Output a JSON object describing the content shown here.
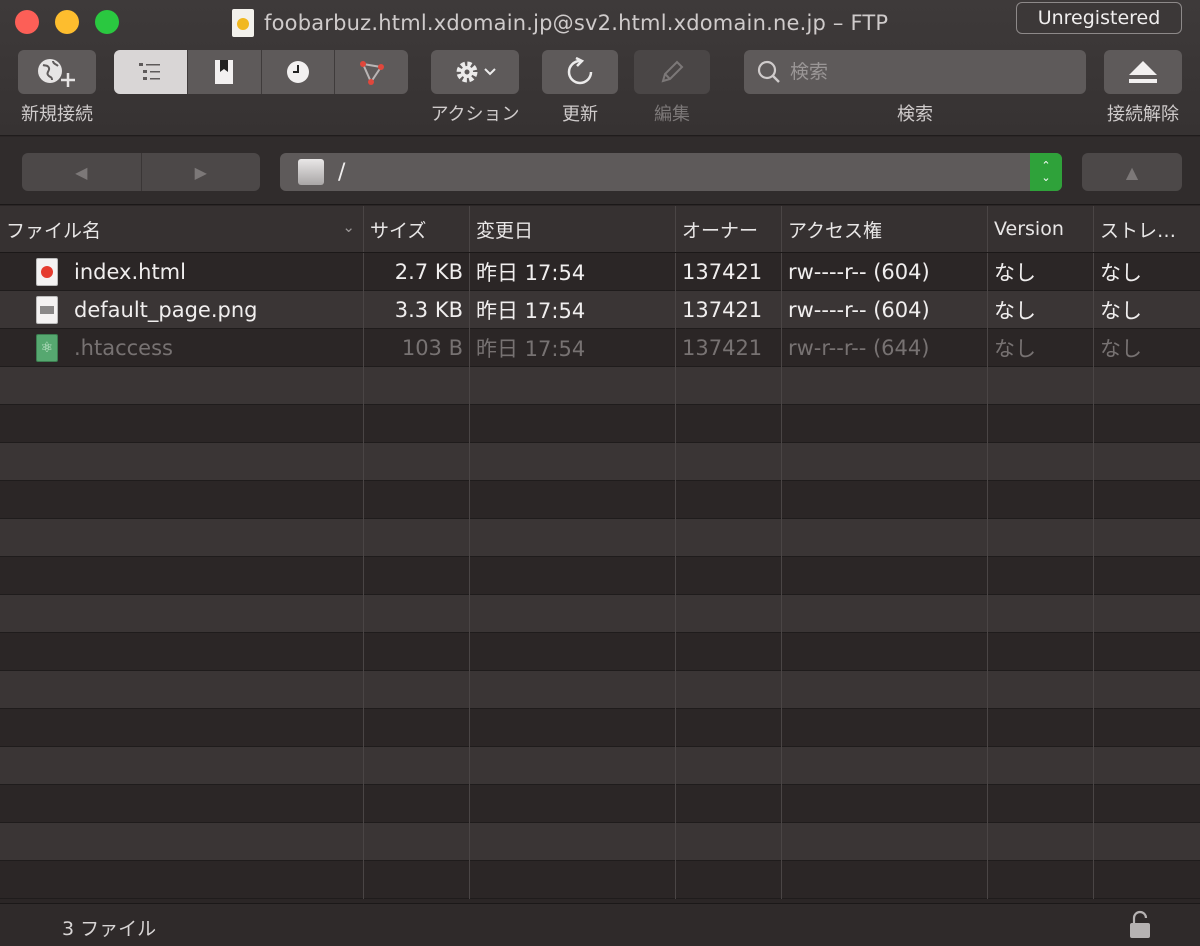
{
  "window": {
    "title": "foobarbuz.html.xdomain.jp@sv2.html.xdomain.ne.jp – FTP",
    "badge": "Unregistered"
  },
  "toolbar": {
    "new_connection_label": "新規接続",
    "action_label": "アクション",
    "refresh_label": "更新",
    "edit_label": "編集",
    "search_label": "検索",
    "search_placeholder": "検索",
    "disconnect_label": "接続解除",
    "view_modes": [
      "browser-list-icon",
      "bookmarks-icon",
      "history-icon",
      "bonjour-icon"
    ],
    "active_view": 0
  },
  "navigation": {
    "back": "◀",
    "forward": "▶",
    "up": "▲",
    "path": "/"
  },
  "table": {
    "columns": [
      "ファイル名",
      "サイズ",
      "変更日",
      "オーナー",
      "アクセス権",
      "Version",
      "ストレ…"
    ],
    "rows": [
      {
        "name": "index.html",
        "size": "2.7 KB",
        "modified": "昨日 17:54",
        "owner": "137421",
        "permissions": "rw----r-- (604)",
        "version": "なし",
        "storage": "なし",
        "icon": "html-file-icon",
        "dimmed": false
      },
      {
        "name": "default_page.png",
        "size": "3.3 KB",
        "modified": "昨日 17:54",
        "owner": "137421",
        "permissions": "rw----r-- (604)",
        "version": "なし",
        "storage": "なし",
        "icon": "png-file-icon",
        "dimmed": false
      },
      {
        "name": ".htaccess",
        "size": "103 B",
        "modified": "昨日 17:54",
        "owner": "137421",
        "permissions": "rw-r--r-- (644)",
        "version": "なし",
        "storage": "なし",
        "icon": "htaccess-file-icon",
        "dimmed": true
      }
    ]
  },
  "status": {
    "count": "3 ファイル"
  }
}
